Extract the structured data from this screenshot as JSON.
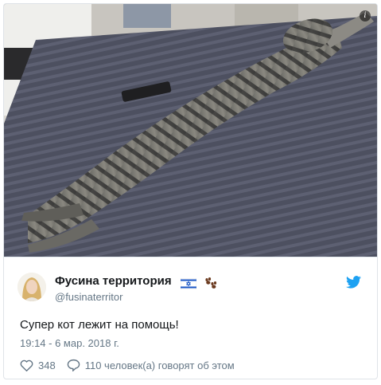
{
  "tweet": {
    "author_name": "Фусина территория",
    "author_handle": "@fusinaterritor",
    "text": "Супер кот лежит на помощь!",
    "timestamp": "19:14 - 6 мар. 2018 г.",
    "likes": "348",
    "replies_text": "110 человек(а) говорят об этом"
  },
  "icons": {
    "info": "info-icon",
    "bird": "twitter-bird-icon",
    "heart": "heart-icon",
    "reply": "speech-bubble-icon",
    "flag": "israel-flag-icon",
    "paw": "paw-prints-icon"
  },
  "colors": {
    "twitter_blue": "#1da1f2",
    "text": "#14171a",
    "muted": "#657786"
  }
}
